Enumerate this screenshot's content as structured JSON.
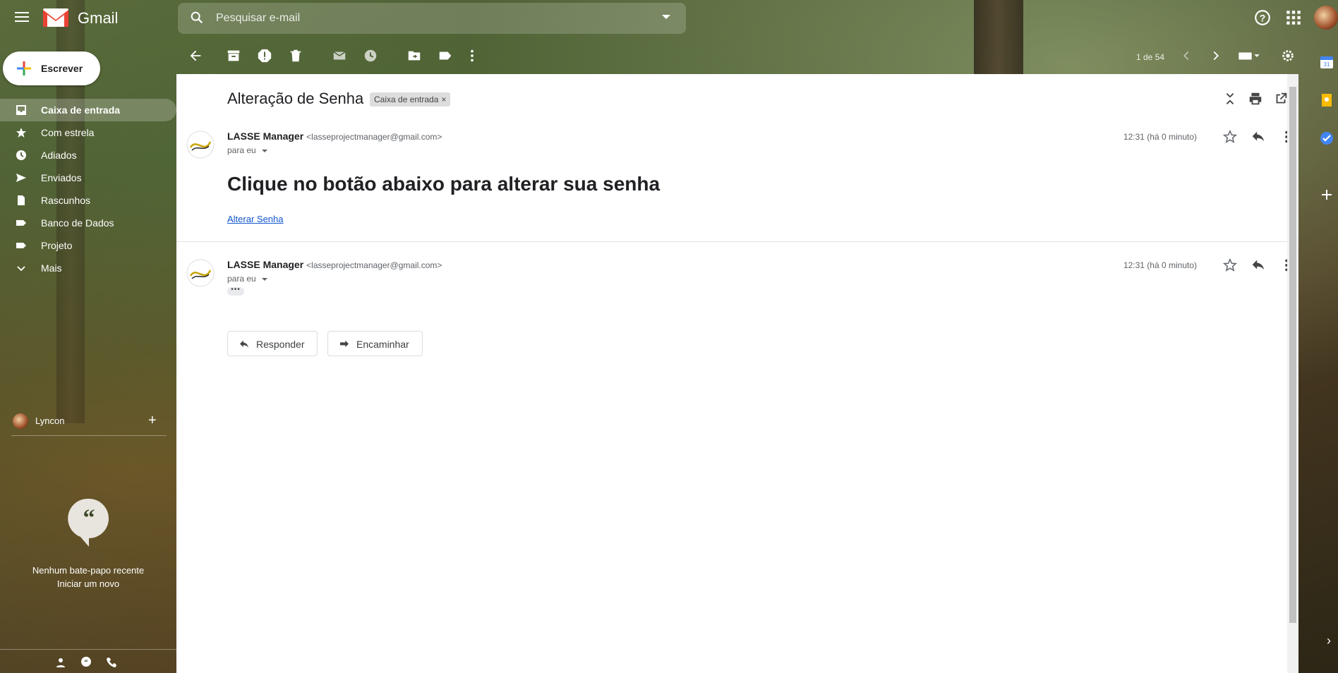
{
  "app": {
    "name": "Gmail"
  },
  "search": {
    "placeholder": "Pesquisar e-mail"
  },
  "compose": {
    "label": "Escrever"
  },
  "nav": [
    {
      "label": "Caixa de entrada",
      "icon": "inbox-icon",
      "active": true
    },
    {
      "label": "Com estrela",
      "icon": "star-icon"
    },
    {
      "label": "Adiados",
      "icon": "clock-icon"
    },
    {
      "label": "Enviados",
      "icon": "send-icon"
    },
    {
      "label": "Rascunhos",
      "icon": "draft-icon"
    },
    {
      "label": "Banco de Dados",
      "icon": "label-icon"
    },
    {
      "label": "Projeto",
      "icon": "label-icon"
    },
    {
      "label": "Mais",
      "icon": "chevron-down-icon"
    }
  ],
  "toolbar": {
    "count": "1 de 54"
  },
  "chat": {
    "user": "Lyncon",
    "empty_line1": "Nenhum bate-papo recente",
    "empty_line2": "Iniciar um novo"
  },
  "thread": {
    "subject": "Alteração de Senha",
    "label": "Caixa de entrada",
    "label_close": "×",
    "messages": [
      {
        "sender": "LASSE Manager",
        "email": "<lasseprojectmanager@gmail.com>",
        "to": "para eu",
        "time": "12:31 (há 0 minuto)",
        "heading": "Clique no botão abaixo para alterar sua senha",
        "link": "Alterar Senha"
      },
      {
        "sender": "LASSE Manager",
        "email": "<lasseprojectmanager@gmail.com>",
        "to": "para eu",
        "time": "12:31 (há 0 minuto)",
        "dots": "•••"
      }
    ],
    "reply_label": "Responder",
    "forward_label": "Encaminhar"
  },
  "colors": {
    "accent_red": "#ea4335",
    "link": "#1155cc"
  }
}
